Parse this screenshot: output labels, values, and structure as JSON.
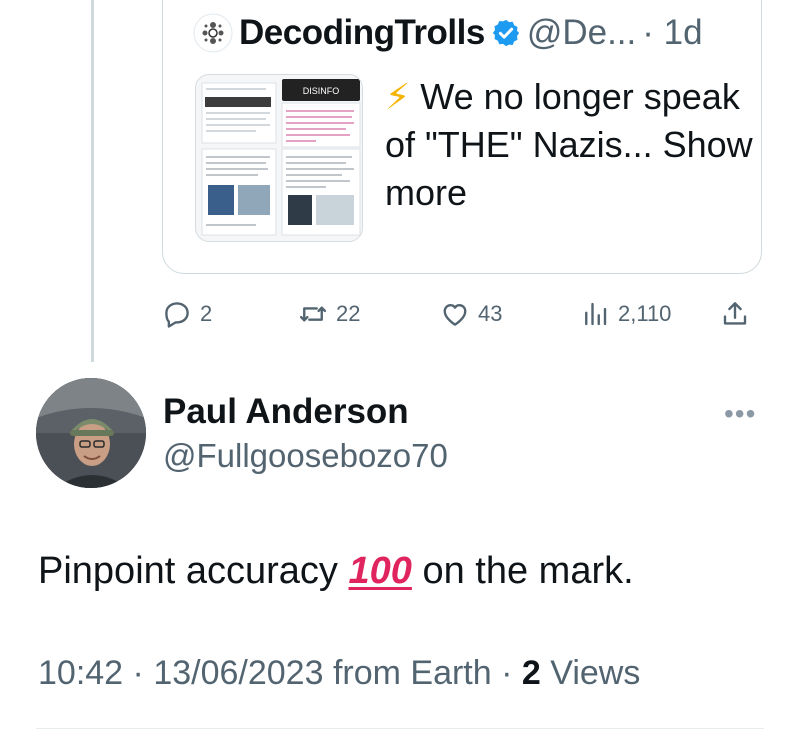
{
  "quote": {
    "name": "DecodingTrolls",
    "handle": "@De...",
    "time": "· 1d",
    "text_emoji": "⚡",
    "text": "We no longer speak of \"THE\" Nazis...",
    "show_more": "Show more",
    "thumb_label": "DISINFO"
  },
  "actions": {
    "replies": "2",
    "retweets": "22",
    "likes": "43",
    "views": "2,110"
  },
  "reply": {
    "name": "Paul Anderson",
    "handle": "@Fullgoosebozo70",
    "more": "•••",
    "text_before": "Pinpoint accuracy",
    "emoji": "100",
    "text_after": "on the mark."
  },
  "meta": {
    "time": "10:42",
    "sep1": "·",
    "date": "13/06/2023",
    "source": "from Earth",
    "sep2": "·",
    "views_count": "2",
    "views_label": "Views"
  },
  "colors": {
    "verified": "#1d9bf0",
    "muted": "#536471",
    "border": "#cfd9de",
    "emoji_red": "#e0245e"
  },
  "icons": [
    "reply-icon",
    "retweet-icon",
    "like-icon",
    "views-icon",
    "share-icon",
    "verified-badge-icon",
    "bolt-icon"
  ]
}
